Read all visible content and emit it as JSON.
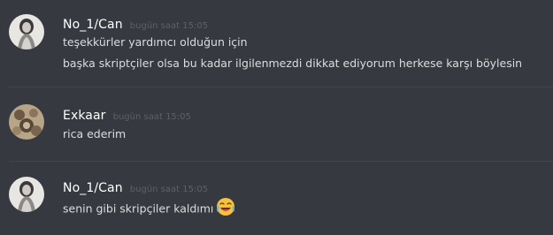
{
  "messages": [
    {
      "username": "No_1/Can",
      "timestamp": "bugün saat 15:05",
      "lines": [
        "teşekkürler yardımcı olduğun için",
        "başka skriptçiler olsa bu kadar ilgilenmezdi dikkat ediyorum herkese karşı böylesin"
      ],
      "avatar": "pale-figure-avatar"
    },
    {
      "username": "Exkaar",
      "timestamp": "bugün saat 15:05",
      "lines": [
        "rica ederim"
      ],
      "avatar": "sepia-pattern-avatar"
    },
    {
      "username": "No_1/Can",
      "timestamp": "bugün saat 15:05",
      "lines": [
        "senin gibi skripçiler kaldımı"
      ],
      "emoji": "joy-emoji",
      "avatar": "pale-figure-avatar"
    }
  ],
  "colors": {
    "background": "#36393f",
    "username": "#ffffff",
    "timestamp": "#5d6166",
    "message_text": "#dcddde",
    "divider": "#42454a"
  }
}
